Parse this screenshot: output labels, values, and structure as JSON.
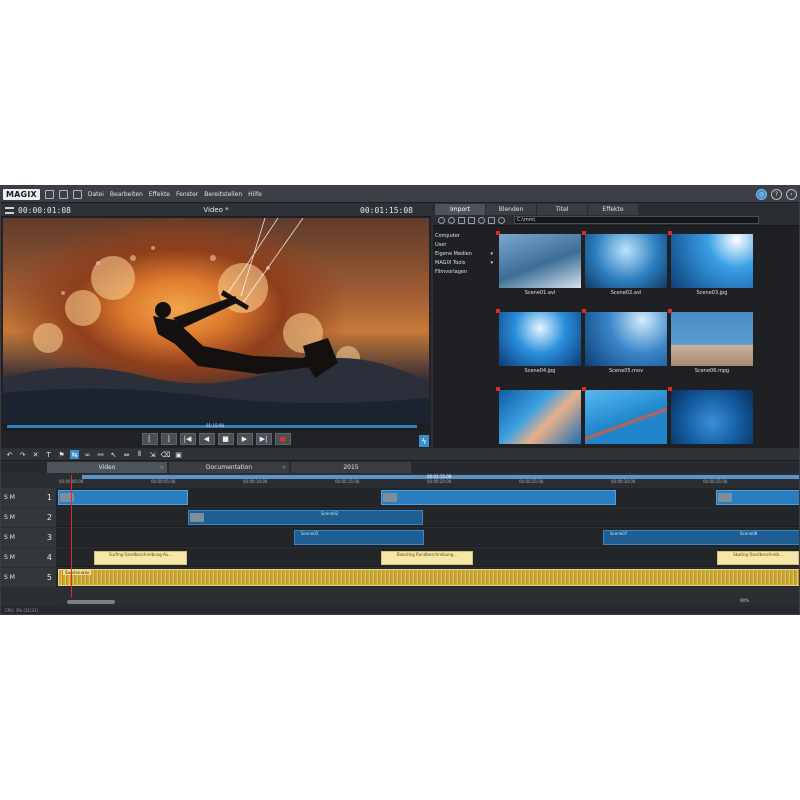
{
  "app": {
    "logo": "MAGIX"
  },
  "menu": [
    "Datei",
    "Bearbeiten",
    "Effekte",
    "Fenster",
    "Bereitstellen",
    "Hilfe"
  ],
  "preview": {
    "timecode_left": "00:00:01:08",
    "title": "Video *",
    "timecode_right": "00:01:15:08",
    "scrub_time": "01:15:08"
  },
  "transport": [
    "[",
    "]",
    "|◀",
    "◀",
    "■",
    "▶",
    "▶|",
    "●"
  ],
  "pool": {
    "tabs": [
      "Import",
      "Blenden",
      "Titel",
      "Effekte"
    ],
    "active_tab": "Import",
    "path": "C:\\mm\\",
    "folders": [
      {
        "label": "Computer",
        "arrow": ""
      },
      {
        "label": "User",
        "arrow": ""
      },
      {
        "label": "Eigene Medien",
        "arrow": "▾"
      },
      {
        "label": "MAGIX Tools",
        "arrow": "▾"
      },
      {
        "label": "Filmvorlagen",
        "arrow": ""
      }
    ],
    "thumbnails": [
      "Scene01.avi",
      "Scene02.avi",
      "Scene03.jpg",
      "Scene04.jpg",
      "Scene05.mov",
      "Scene06.mpg",
      "",
      "",
      ""
    ]
  },
  "timeline": {
    "tabs": [
      "Video",
      "Documentation",
      "2015"
    ],
    "ruler_labels": [
      "00:00:00:00",
      "00:00:05:00",
      "00:00:10:00",
      "00:00:15:00",
      "00:00:20:00",
      "00:00:25:00",
      "00:00:30:00",
      "00:00:35:00"
    ],
    "cursor_time": "00:01:15:08",
    "tracks": [
      {
        "label": "S M",
        "number": "1"
      },
      {
        "label": "S M",
        "number": "2"
      },
      {
        "label": "S M",
        "number": "3"
      },
      {
        "label": "S M",
        "number": "4"
      },
      {
        "label": "S M",
        "number": "5"
      }
    ],
    "clip_labels": {
      "scene02": "Scene02",
      "scene05": "Scene05",
      "scene07": "Scene07",
      "scene08": "Scene08"
    },
    "title_clips": [
      "Surfing  Randbeschreibung-Au...",
      "Boarding  Randbeschreibung...",
      "Skating  Randbeschreib..."
    ],
    "audio_clip": "Sunrise.wav",
    "zoom": "90%"
  },
  "status": "CPU: 3% (31/31)"
}
